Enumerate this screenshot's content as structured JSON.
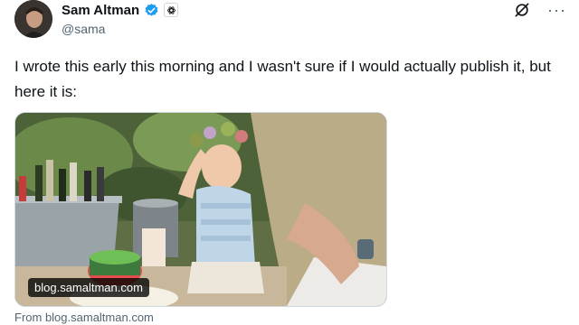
{
  "author": {
    "name": "Sam Altman",
    "handle": "@sama",
    "verified": true,
    "verified_color": "#1d9bf0",
    "org_badge_icon": "openai-icon"
  },
  "actions": {
    "grok_icon": "grok-icon",
    "more_icon": "more-icon",
    "more_label": "···"
  },
  "tweet": {
    "text": "I wrote this early this morning and I wasn't sure if I would actually publish it, but here it is:"
  },
  "link_card": {
    "domain_overlay": "blog.samaltman.com",
    "source_label": "From blog.samaltman.com"
  }
}
